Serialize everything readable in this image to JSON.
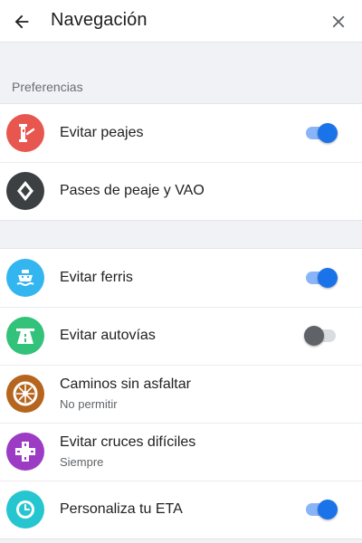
{
  "header": {
    "title": "Navegación",
    "back_icon": "arrow-back-icon",
    "close_icon": "close-icon"
  },
  "preferences": {
    "section_label": "Preferencias",
    "items": [
      {
        "title": "Evitar peajes",
        "icon": "toll-booth-icon",
        "icon_color": "#e8574f",
        "toggle": true
      },
      {
        "title": "Pases de peaje y VAO",
        "icon": "diamond-lane-icon",
        "icon_color": "#3c4043"
      }
    ]
  },
  "options": {
    "items": [
      {
        "title": "Evitar ferris",
        "icon": "ferry-icon",
        "icon_color": "#33b5f0",
        "toggle": true
      },
      {
        "title": "Evitar autovías",
        "icon": "highway-icon",
        "icon_color": "#33c27a",
        "toggle": false
      },
      {
        "title": "Caminos sin asfaltar",
        "subtitle": "No permitir",
        "icon": "wheel-icon",
        "icon_color": "#b5651d"
      },
      {
        "title": "Evitar cruces difíciles",
        "subtitle": "Siempre",
        "icon": "intersection-icon",
        "icon_color": "#9c3cc4"
      },
      {
        "title": "Personaliza tu ETA",
        "icon": "clock-icon",
        "icon_color": "#25c6d0",
        "toggle": true
      }
    ]
  }
}
